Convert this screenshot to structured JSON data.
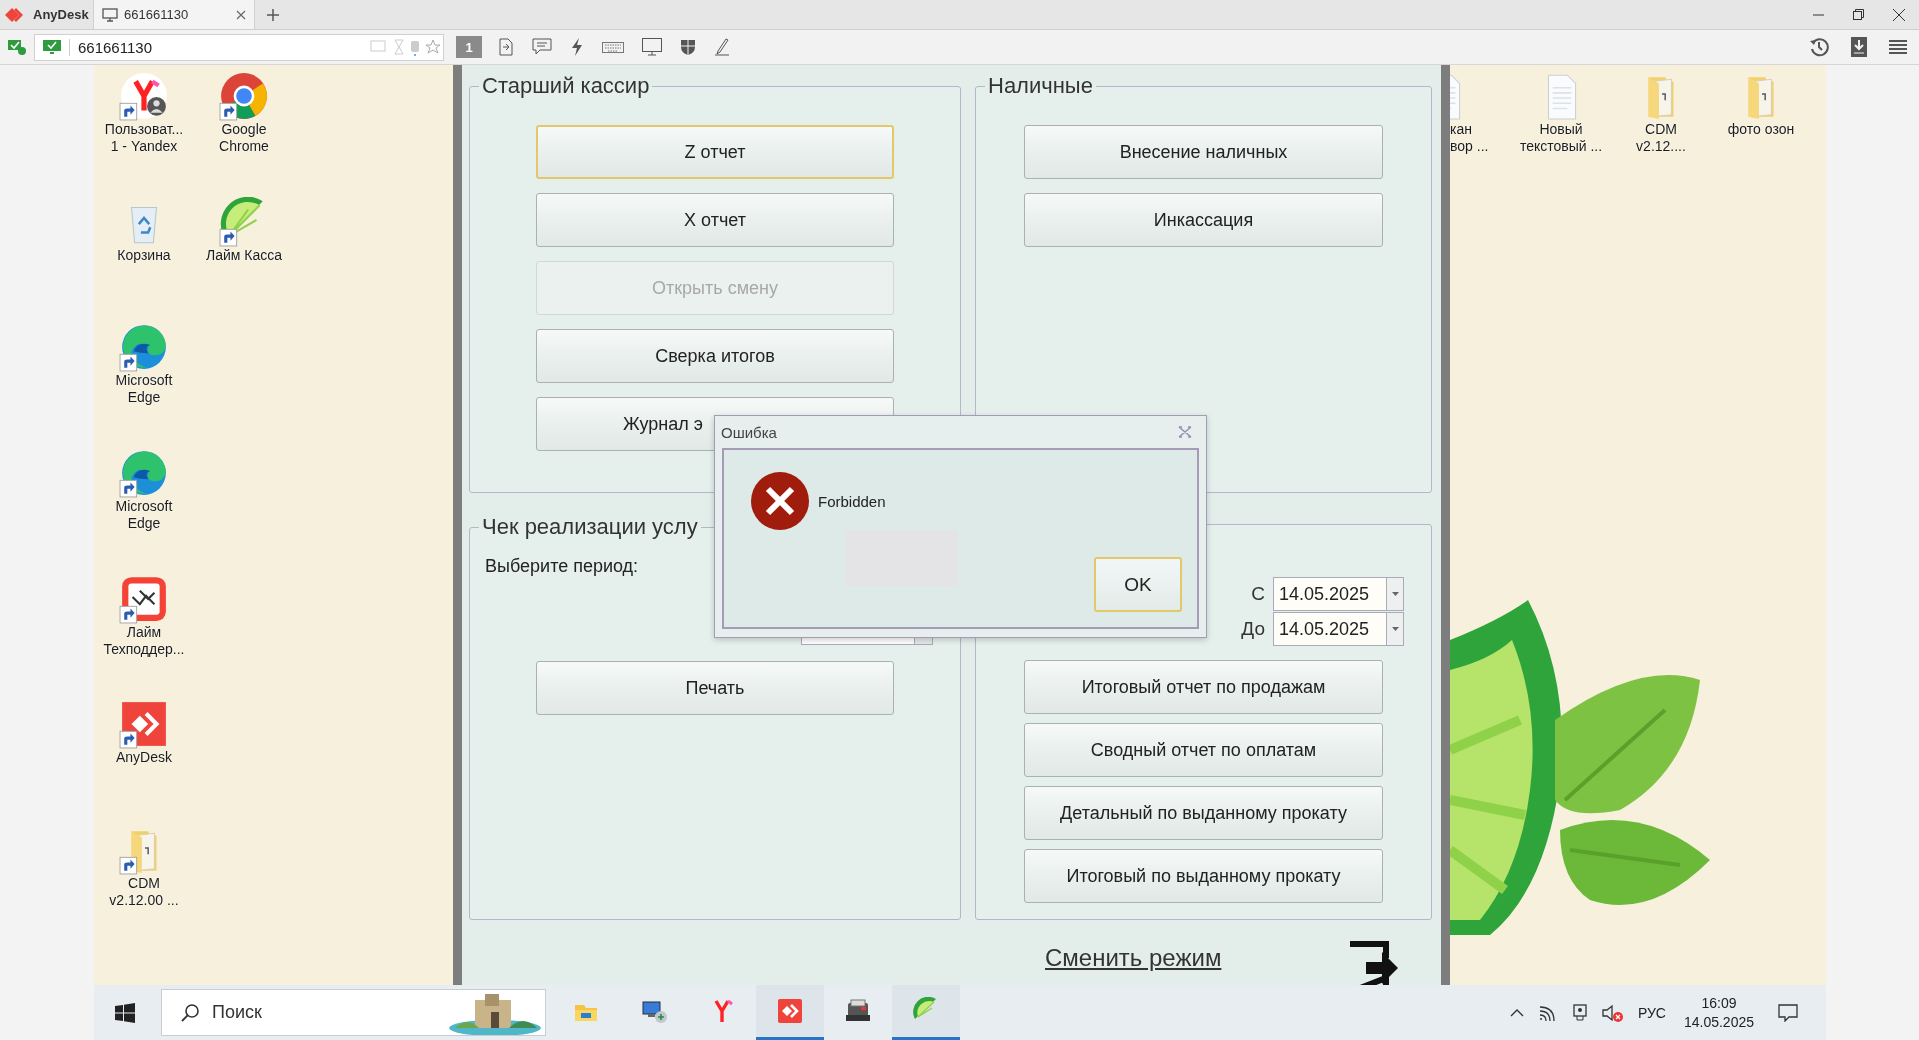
{
  "anydesk": {
    "brand": "AnyDesk",
    "tabs": [
      {
        "label": "661661130",
        "selected": true
      }
    ],
    "address": "661661130",
    "monitor": "1"
  },
  "desktop": {
    "left_columns": [
      [
        {
          "kind": "yandex",
          "shortcut": true,
          "lines": [
            "Пользоват...",
            "1 - Yandex"
          ]
        },
        {
          "kind": "recycle",
          "shortcut": false,
          "lines": [
            "Корзина"
          ]
        },
        {
          "kind": "edge",
          "shortcut": true,
          "lines": [
            "Microsoft",
            "Edge"
          ]
        },
        {
          "kind": "edge",
          "shortcut": true,
          "lines": [
            "Microsoft",
            "Edge"
          ]
        },
        {
          "kind": "support",
          "shortcut": true,
          "lines": [
            "Лайм",
            "Техподдер..."
          ]
        },
        {
          "kind": "anydesk",
          "shortcut": true,
          "lines": [
            "AnyDesk"
          ]
        },
        {
          "kind": "folder",
          "shortcut": true,
          "lines": [
            "CDM",
            "v2.12.00 ..."
          ]
        }
      ],
      [
        {
          "kind": "chrome",
          "shortcut": true,
          "lines": [
            "Google",
            "Chrome"
          ]
        },
        {
          "kind": "lime",
          "shortcut": true,
          "lines": [
            "Лайм Касса"
          ]
        }
      ]
    ],
    "right_icons": [
      {
        "kind": "document",
        "shortcut": false,
        "cut": true,
        "lines": [
          "кан",
          "вор ..."
        ]
      },
      {
        "kind": "document",
        "shortcut": false,
        "cut": false,
        "lines": [
          "Новый",
          "текстовый ..."
        ]
      },
      {
        "kind": "folder",
        "shortcut": false,
        "cut": false,
        "lines": [
          "CDM",
          "v2.12...."
        ]
      },
      {
        "kind": "folder",
        "shortcut": false,
        "cut": false,
        "lines": [
          "фото озон"
        ]
      }
    ]
  },
  "app": {
    "cashier": {
      "title": "Старший кассир",
      "buttons": [
        {
          "label": "Z отчет",
          "kind": "full",
          "focused": true,
          "disabled": false
        },
        {
          "label": "X отчет",
          "kind": "full",
          "focused": false,
          "disabled": false
        },
        {
          "label": "Открыть смену",
          "kind": "full",
          "focused": false,
          "disabled": true
        },
        {
          "label": "Сверка итогов",
          "kind": "full",
          "focused": false,
          "disabled": false
        },
        {
          "label": "Журнал э",
          "kind": "cut",
          "focused": false,
          "disabled": false
        }
      ]
    },
    "cash": {
      "title": "Наличные",
      "buttons": [
        "Внесение наличных",
        "Инкассация"
      ]
    },
    "service_check": {
      "title": "Чек реализации услу",
      "period_label": "Выберите период:",
      "print_button": "Печать"
    },
    "reports": {
      "from_label": "С",
      "from_date": "14.05.2025",
      "to_label": "До",
      "to_date": "14.05.2025",
      "buttons": [
        "Итоговый отчет по продажам",
        "Сводный отчет по оплатам",
        "Детальный по выданному прокату",
        "Итоговый по выданному прокату"
      ]
    },
    "mode_link": "Сменить режим"
  },
  "dialog": {
    "title": "Ошибка",
    "message": "Forbidden",
    "ok": "OK"
  },
  "taskbar": {
    "search_placeholder": "Поиск",
    "apps": [
      {
        "kind": "explorer",
        "running": false
      },
      {
        "kind": "network",
        "running": false
      },
      {
        "kind": "yandex",
        "running": false
      },
      {
        "kind": "anydesk",
        "running": true
      },
      {
        "kind": "register",
        "running": false
      },
      {
        "kind": "lime",
        "running": true
      }
    ],
    "language": "РУС",
    "time": "16:09",
    "date": "14.05.2025"
  }
}
